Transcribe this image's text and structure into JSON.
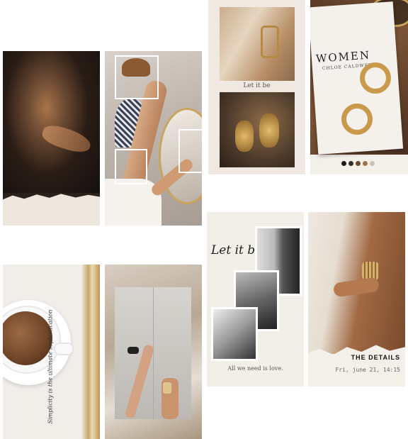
{
  "stories": {
    "earrings": {
      "caption": "Let it be"
    },
    "card": {
      "title": "WOMEN",
      "subtitle": "CHLOE CALDWELL"
    },
    "palette": [
      "#1f1a17",
      "#3b2c22",
      "#6b4a32",
      "#9b7450",
      "#c9c2b8"
    ],
    "quote": {
      "text": "Simplicity is the ultimate sophistication"
    },
    "letitbe": {
      "title": "Let it be",
      "caption": "All we need is love."
    },
    "details": {
      "title": "THE DETAILS",
      "date": "Fri, june 21, 14:15"
    }
  }
}
